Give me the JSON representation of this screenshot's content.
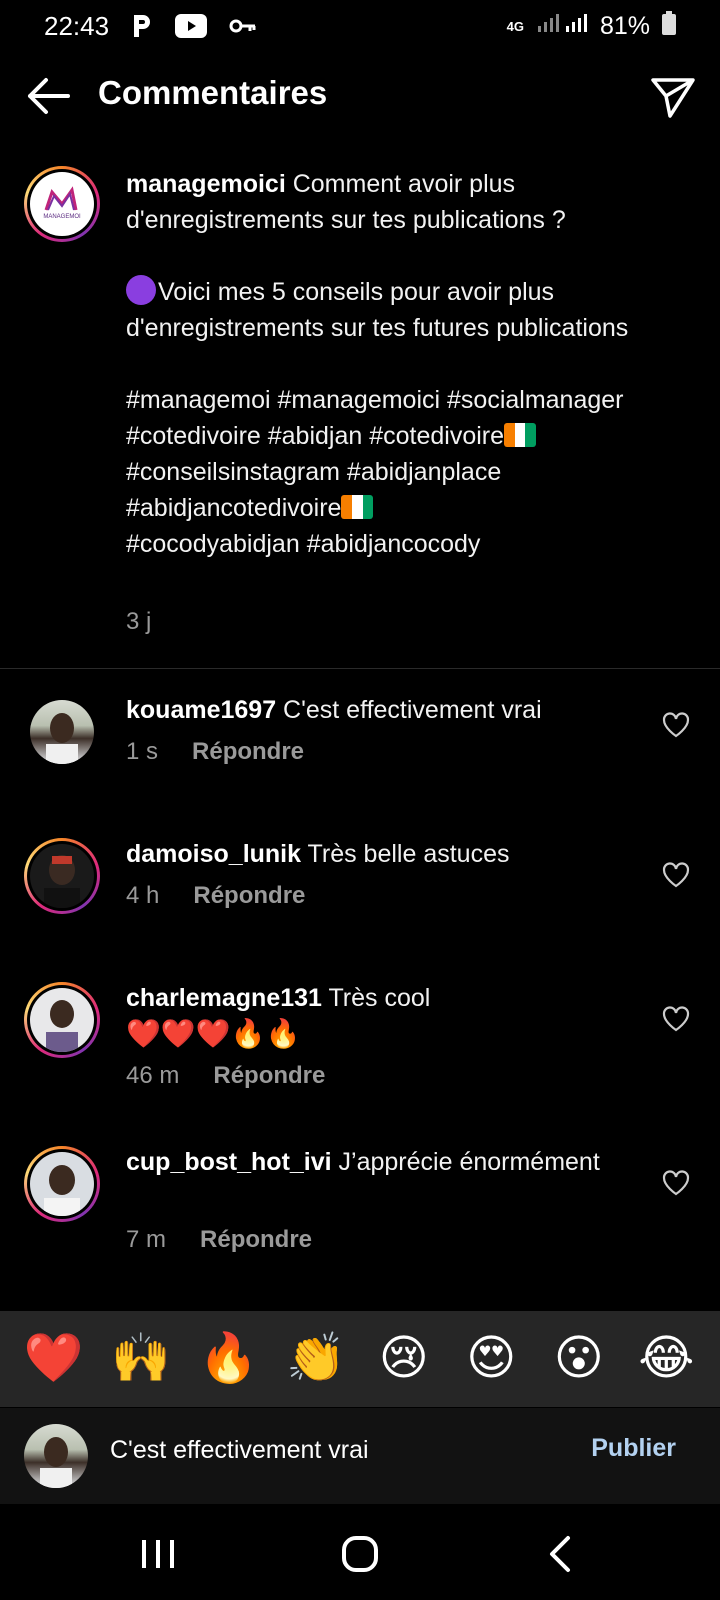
{
  "status_bar": {
    "time": "22:43",
    "network": "4G",
    "battery": "81%",
    "icons": [
      "parking-icon",
      "youtube-icon",
      "key-icon",
      "signal-icon",
      "battery-icon"
    ]
  },
  "header": {
    "title": "Commentaires",
    "back_icon": "arrow-left-icon",
    "send_icon": "send-icon"
  },
  "caption": {
    "username": "managemoici",
    "avatar_text": "MANAGEMOI",
    "line1": " Comment avoir plus d'enregistrements sur tes publications ?",
    "line2": "Voici mes 5 conseils pour avoir plus d'enregistrements sur tes futures publications",
    "hashtags_a": "#managemoi #managemoici #socialmanager #cotedivoire #abidjan #cotedivoire",
    "hashtags_b": " #conseilsinstagram #abidjanplace #abidjancotedivoire",
    "hashtags_c": "#cocodyabidjan #abidjancocody",
    "time": "3 j"
  },
  "comments": [
    {
      "username": "kouame1697",
      "text": " C'est effectivement vrai",
      "time": "1 s",
      "reply": "Répondre"
    },
    {
      "username": "damoiso_lunik",
      "text": " Très belle astuces",
      "time": "4 h",
      "reply": "Répondre"
    },
    {
      "username": "charlemagne131",
      "text": " Très cool",
      "emojis": "❤️❤️❤️🔥🔥",
      "time": "46 m",
      "reply": "Répondre"
    },
    {
      "username": "cup_bost_hot_ivi",
      "text": " J’apprécie énormément",
      "time": "7 m",
      "reply": "Répondre"
    }
  ],
  "reactions": [
    "❤️",
    "🙌",
    "🔥",
    "👏",
    "😢",
    "😍",
    "😮",
    "😂"
  ],
  "composer": {
    "value": "C'est effectivement vrai",
    "publish_label": "Publier"
  },
  "colors": {
    "background": "#000000",
    "publish": "#b3d1f0",
    "ring_start": "#f58529",
    "ring_mid": "#dd2a7b",
    "ci_orange": "#f77f00",
    "ci_green": "#009e60"
  }
}
